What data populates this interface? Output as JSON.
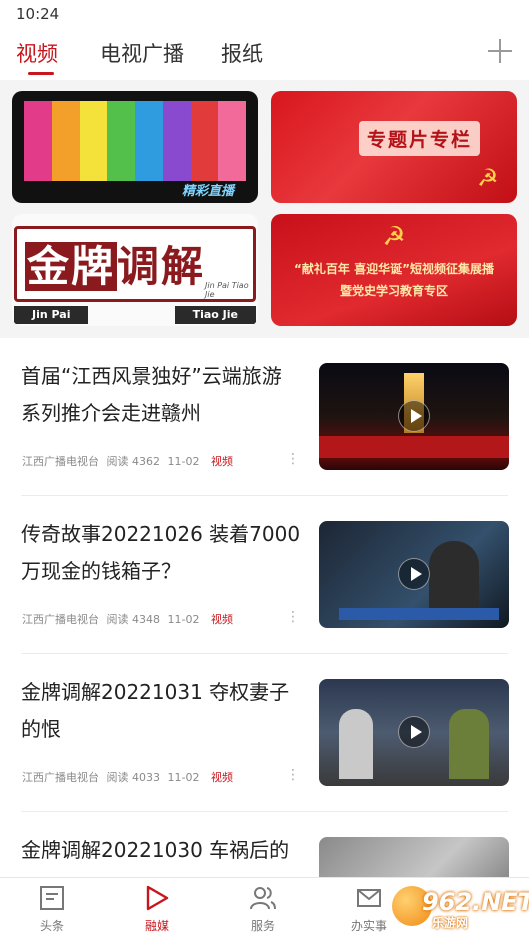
{
  "status_bar": {
    "time": "10:24"
  },
  "top_tabs": {
    "tabs": [
      {
        "label": "视频",
        "active": true
      },
      {
        "label": "电视广播",
        "active": false
      },
      {
        "label": "报纸",
        "active": false
      }
    ],
    "add_icon": "plus-icon",
    "accent_color": "#c8161d"
  },
  "banners": [
    {
      "caption": "精彩直播"
    },
    {
      "caption": "专题片专栏"
    },
    {
      "title_a": "金牌",
      "title_b": "调解",
      "sub": "Jin Pai Tiao Jie",
      "bar_left": "Jin Pai",
      "bar_right": "Tiao Jie"
    },
    {
      "line1": "“献礼百年 喜迎华诞”短视频征集展播",
      "line2": "暨党史学习教育专区"
    }
  ],
  "news": [
    {
      "title": "首届“江西风景独好”云端旅游系列推介会走进赣州",
      "source": "江西广播电视台",
      "reads": "阅读 4362",
      "date": "11-02",
      "tag": "视频"
    },
    {
      "title": "传奇故事20221026 装着7000万现金的钱箱子？",
      "source": "江西广播电视台",
      "reads": "阅读 4348",
      "date": "11-02",
      "tag": "视频"
    },
    {
      "title": "金牌调解20221031 夺权妻子的恨",
      "source": "江西广播电视台",
      "reads": "阅读 4033",
      "date": "11-02",
      "tag": "视频"
    },
    {
      "title": "金牌调解20221030 车祸后的",
      "source": "",
      "reads": "",
      "date": "",
      "tag": ""
    }
  ],
  "bottom_nav": [
    {
      "label": "头条",
      "icon": "news-icon",
      "active": false
    },
    {
      "label": "融媒",
      "icon": "play-icon",
      "active": true
    },
    {
      "label": "服务",
      "icon": "users-icon",
      "active": false
    },
    {
      "label": "办实事",
      "icon": "mail-icon",
      "active": false
    }
  ],
  "watermark": {
    "text": "962.NET",
    "sub": "乐游网"
  }
}
